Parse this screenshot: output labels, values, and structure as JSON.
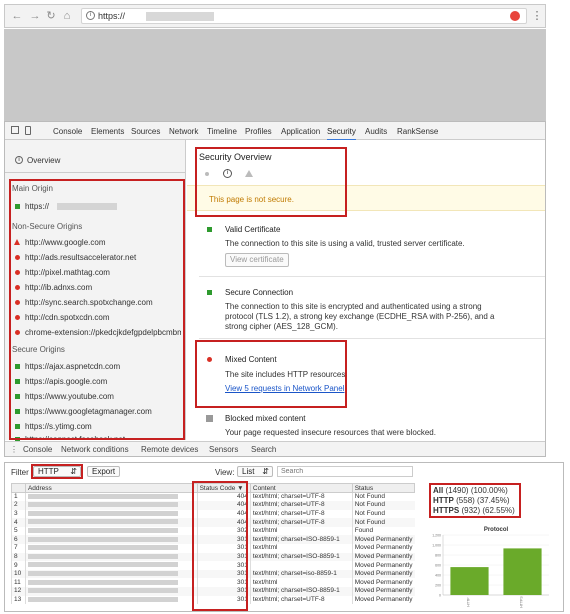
{
  "browser": {
    "url_text": "https://",
    "back_icon": "arrow-left-icon",
    "forward_icon": "arrow-right-icon",
    "reload_icon": "reload-icon",
    "home_icon": "home-icon",
    "lock_icon": "info-icon",
    "menu_icon": "kebab-menu-icon"
  },
  "devtools": {
    "tabs": [
      "Console",
      "Elements",
      "Sources",
      "Network",
      "Timeline",
      "Profiles",
      "Application",
      "Security",
      "Audits",
      "RankSense"
    ],
    "active_tab": "Security",
    "sidebar": {
      "overview_label": "Overview",
      "main_origin_heading": "Main Origin",
      "main_origin": "https://",
      "non_secure_heading": "Non-Secure Origins",
      "non_secure": [
        "http://www.google.com",
        "http://ads.resultsaccelerator.net",
        "http://pixel.mathtag.com",
        "http://ib.adnxs.com",
        "http://sync.search.spotxchange.com",
        "http://cdn.spotxcdn.com",
        "chrome-extension://pkedcjkdefgpdelpbcmbme"
      ],
      "secure_heading": "Secure Origins",
      "secure": [
        "https://ajax.aspnetcdn.com",
        "https://apis.google.com",
        "https://www.youtube.com",
        "https://www.googletagmanager.com",
        "https://s.ytimg.com",
        "https://connect.facebook.net"
      ]
    },
    "main": {
      "overview_title": "Security Overview",
      "not_secure_msg": "This page is not secure.",
      "cert_title": "Valid Certificate",
      "cert_desc": "The connection to this site is using a valid, trusted server certificate.",
      "cert_button": "View certificate",
      "conn_title": "Secure Connection",
      "conn_desc_1": "The connection to this site is encrypted and authenticated using a strong",
      "conn_desc_2": "protocol (TLS 1.2), a strong key exchange (ECDHE_RSA with P-256), and a",
      "conn_desc_3": "strong cipher (AES_128_GCM).",
      "mixed_title": "Mixed Content",
      "mixed_desc": "The site includes HTTP resources.",
      "mixed_link": "View 5 requests in Network Panel",
      "blocked_title": "Blocked mixed content",
      "blocked_desc": "Your page requested insecure resources that were blocked."
    },
    "drawer_tabs": [
      "Console",
      "Network conditions",
      "Remote devices",
      "Sensors",
      "Search"
    ]
  },
  "crawler": {
    "filter_label": "Filter",
    "filter_value": "HTTP",
    "export_label": "Export",
    "view_label": "View:",
    "view_value": "List",
    "search_placeholder": "Search",
    "columns": [
      "",
      "Address",
      "Status Code",
      "Content",
      "Status"
    ],
    "rows": [
      {
        "n": "1",
        "code": "404",
        "content": "text/html; charset=UTF-8",
        "status": "Not Found"
      },
      {
        "n": "2",
        "code": "404",
        "content": "text/html; charset=UTF-8",
        "status": "Not Found"
      },
      {
        "n": "3",
        "code": "404",
        "content": "text/html; charset=UTF-8",
        "status": "Not Found"
      },
      {
        "n": "4",
        "code": "404",
        "content": "text/html; charset=UTF-8",
        "status": "Not Found"
      },
      {
        "n": "5",
        "code": "302",
        "content": "text/html",
        "status": "Found"
      },
      {
        "n": "6",
        "code": "301",
        "content": "text/html; charset=ISO-8859-1",
        "status": "Moved Permanently"
      },
      {
        "n": "7",
        "code": "301",
        "content": "text/html",
        "status": "Moved Permanently"
      },
      {
        "n": "8",
        "code": "301",
        "content": "text/html; charset=ISO-8859-1",
        "status": "Moved Permanently"
      },
      {
        "n": "9",
        "code": "301",
        "content": "",
        "status": "Moved Permanently"
      },
      {
        "n": "10",
        "code": "301",
        "content": "text/html; charset=iso-8859-1",
        "status": "Moved Permanently"
      },
      {
        "n": "11",
        "code": "301",
        "content": "text/html",
        "status": "Moved Permanently"
      },
      {
        "n": "12",
        "code": "301",
        "content": "text/html; charset=ISO-8859-1",
        "status": "Moved Permanently"
      },
      {
        "n": "13",
        "code": "301",
        "content": "text/html; charset=UTF-8",
        "status": "Moved Permanently"
      }
    ],
    "summary": [
      {
        "label": "All",
        "value": "(1490) (100.00%)"
      },
      {
        "label": "HTTP",
        "value": "(558) (37.45%)"
      },
      {
        "label": "HTTPS",
        "value": "(932) (62.55%)"
      }
    ]
  },
  "chart_data": {
    "type": "bar",
    "title": "Protocol",
    "categories": [
      "HTTP",
      "HTTPS"
    ],
    "values": [
      558,
      932
    ],
    "ylim": [
      0,
      1200
    ],
    "yticks": [
      "1,200",
      "1,000",
      "800",
      "600",
      "400",
      "200",
      "0"
    ],
    "color": "#6aaa2a",
    "grid": true
  },
  "colors": {
    "highlight": "#c62020",
    "accent": "#3879d9",
    "warning_bg": "#fffbe6"
  }
}
